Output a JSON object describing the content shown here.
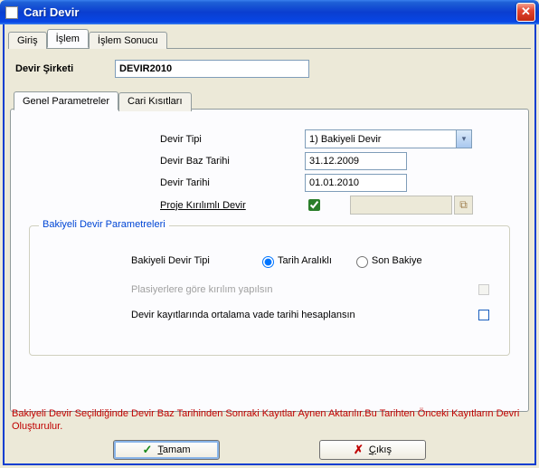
{
  "window": {
    "title": "Cari Devir"
  },
  "top_tabs": {
    "giris": "Giriş",
    "islem": "İşlem",
    "islem_sonucu": "İşlem Sonucu"
  },
  "form": {
    "devir_sirketi_label": "Devir Şirketi",
    "devir_sirketi_value": "DEVIR2010"
  },
  "inner_tabs": {
    "genel": "Genel Parametreler",
    "kisit": "Cari Kısıtları"
  },
  "fields": {
    "devir_tipi_label": "Devir Tipi",
    "devir_tipi_value": "1) Bakiyeli Devir",
    "devir_baz_tarihi_label": "Devir Baz Tarihi",
    "devir_baz_tarihi_value": "31.12.2009",
    "devir_tarihi_label": "Devir Tarihi",
    "devir_tarihi_value": "01.01.2010",
    "proje_kirilimli_label": "Proje Kırılımlı Devir",
    "proje_kirilimli_checked": true
  },
  "group": {
    "legend": "Bakiyeli Devir Parametreleri",
    "bakiyeli_tipi_label": "Bakiyeli Devir Tipi",
    "radio_tarih": "Tarih Aralıklı",
    "radio_son": "Son Bakiye",
    "plasiyer_label": "Plasiyerlere göre kırılım yapılsın",
    "vade_label": "Devir kayıtlarında ortalama vade tarihi hesaplansın"
  },
  "help_text": "Bakiyeli Devir Seçildiğinde Devir Baz Tarihinden Sonraki Kayıtlar Aynen Aktarılır.Bu Tarihten Önceki Kayıtların Devri Oluşturulur.",
  "buttons": {
    "ok": "Tamam",
    "cancel": "Çıkış"
  }
}
